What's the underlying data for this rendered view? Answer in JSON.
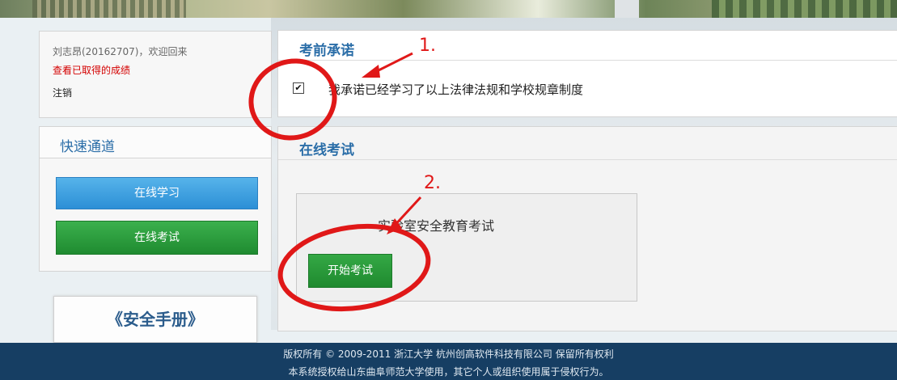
{
  "user": {
    "welcome": "刘志昂(20162707)，欢迎回来",
    "scores_link": "查看已取得的成绩",
    "logout": "注销"
  },
  "quick": {
    "title": "快速通道",
    "study": "在线学习",
    "exam": "在线考试"
  },
  "manual": "《安全手册》",
  "pledge": {
    "title": "考前承诺",
    "checkbox_mark": "✔",
    "text": "我承诺已经学习了以上法律法规和学校规章制度"
  },
  "exam": {
    "title": "在线考试",
    "name": "实验室安全教育考试",
    "start": "开始考试"
  },
  "footer": {
    "line1": "版权所有 © 2009-2011  浙江大学  杭州创高软件科技有限公司  保留所有权利",
    "line2": "本系统授权给山东曲阜师范大学使用，其它个人或组织使用属于侵权行为。"
  },
  "annotations": {
    "one": "1.",
    "two": "2."
  },
  "colors": {
    "accent_red": "#e01818",
    "title_blue": "#2b6ea8",
    "footer_bg": "#163e63"
  }
}
